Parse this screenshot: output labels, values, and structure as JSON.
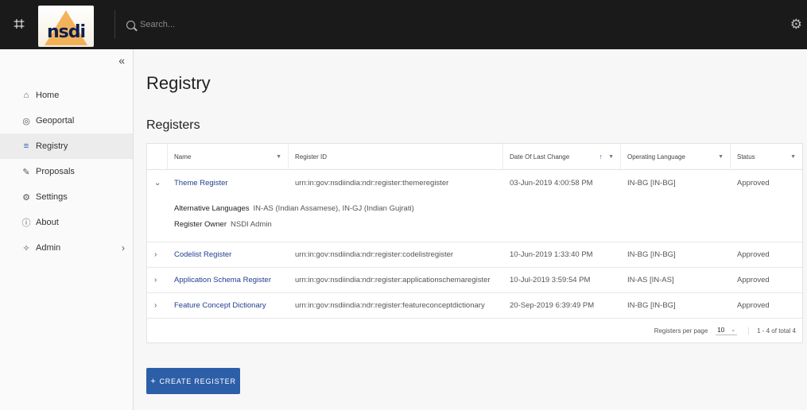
{
  "header": {
    "logo_text": "nsdi",
    "search_placeholder": "Search..."
  },
  "sidebar": {
    "items": [
      {
        "label": "Home",
        "icon": "home-icon"
      },
      {
        "label": "Geoportal",
        "icon": "globe-icon"
      },
      {
        "label": "Registry",
        "icon": "list-icon"
      },
      {
        "label": "Proposals",
        "icon": "pen-icon"
      },
      {
        "label": "Settings",
        "icon": "gear-icon"
      },
      {
        "label": "About",
        "icon": "info-icon"
      },
      {
        "label": "Admin",
        "icon": "wrench-icon"
      }
    ]
  },
  "main": {
    "title": "Registry",
    "section_title": "Registers",
    "table": {
      "columns": [
        "Name",
        "Register ID",
        "Date Of Last Change",
        "Operating Language",
        "Status"
      ],
      "rows": [
        {
          "name": "Theme Register",
          "id": "urn:in:gov:nsdiindia:ndr:register:themeregister",
          "date": "03-Jun-2019 4:00:58 PM",
          "lang": "IN-BG [IN-BG]",
          "status": "Approved"
        },
        {
          "name": "Codelist Register",
          "id": "urn:in:gov:nsdiindia:ndr:register:codelistregister",
          "date": "10-Jun-2019 1:33:40 PM",
          "lang": "IN-BG [IN-BG]",
          "status": "Approved"
        },
        {
          "name": "Application Schema Register",
          "id": "urn:in:gov:nsdiindia:ndr:register:applicationschemaregister",
          "date": "10-Jul-2019 3:59:54 PM",
          "lang": "IN-AS [IN-AS]",
          "status": "Approved"
        },
        {
          "name": "Feature Concept Dictionary",
          "id": "urn:in:gov:nsdiindia:ndr:register:featureconceptdictionary",
          "date": "20-Sep-2019 6:39:49 PM",
          "lang": "IN-BG [IN-BG]",
          "status": "Approved"
        }
      ],
      "expanded": {
        "alt_lang_label": "Alternative Languages",
        "alt_lang_value": "IN-AS (Indian Assamese), IN-GJ (Indian Gujrati)",
        "owner_label": "Register Owner",
        "owner_value": "NSDI Admin"
      },
      "footer": {
        "per_page_label": "Registers per page",
        "per_page_value": "10",
        "range": "1 - 4 of total 4"
      }
    },
    "create_button": "CREATE REGISTER"
  },
  "colors": {
    "topbar": "#1a1a1a",
    "accent": "#2d5fa8",
    "link": "#1f3f8f"
  }
}
